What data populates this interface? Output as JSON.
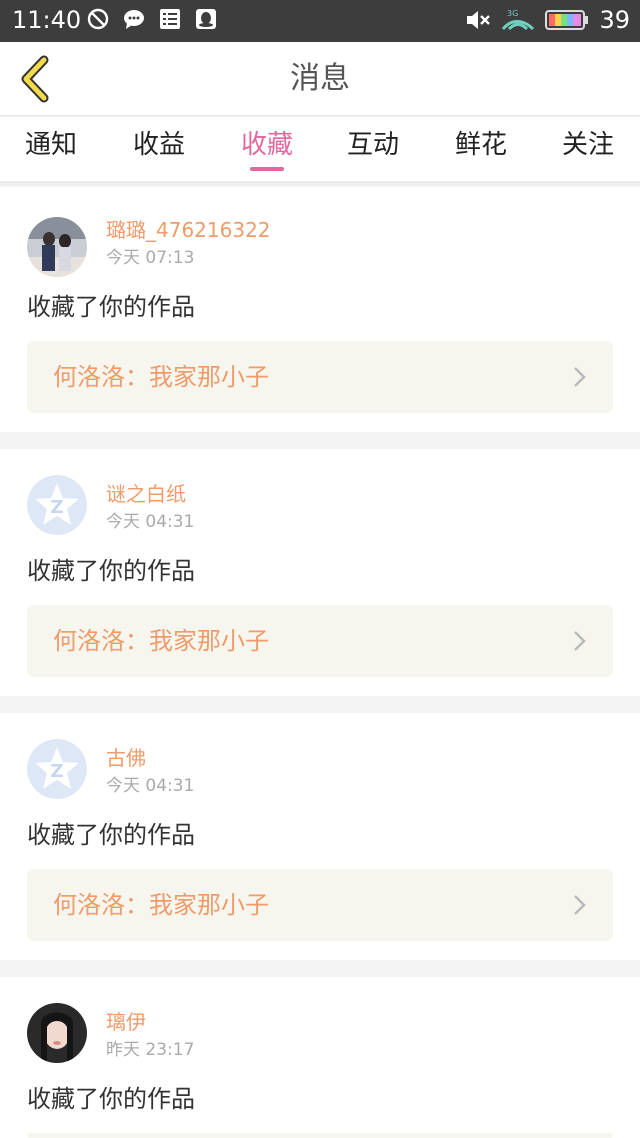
{
  "status_bar": {
    "time": "11:40",
    "battery": "39",
    "icons": [
      "block-icon",
      "chat-icon",
      "list-icon",
      "qq-icon",
      "mute-icon",
      "network-3g-icon",
      "battery-icon"
    ]
  },
  "header": {
    "title": "消息",
    "back_icon": "back-arrow-icon"
  },
  "tabs": [
    {
      "label": "通知",
      "active": false
    },
    {
      "label": "收益",
      "active": false
    },
    {
      "label": "收藏",
      "active": true
    },
    {
      "label": "互动",
      "active": false
    },
    {
      "label": "鲜花",
      "active": false
    },
    {
      "label": "关注",
      "active": false
    }
  ],
  "colors": {
    "accent_pink": "#e5689c",
    "name_orange": "#f09b69",
    "work_box_bg": "#f6f6ef"
  },
  "messages": [
    {
      "username": "璐璐_476216322",
      "time": "今天 07:13",
      "action": "收藏了你的作品",
      "work": "何洛洛：我家那小子",
      "avatar": "photo-avatar"
    },
    {
      "username": "谜之白纸",
      "time": "今天 04:31",
      "action": "收藏了你的作品",
      "work": "何洛洛：我家那小子",
      "avatar": "default-qq-avatar"
    },
    {
      "username": "古佛",
      "time": "今天 04:31",
      "action": "收藏了你的作品",
      "work": "何洛洛：我家那小子",
      "avatar": "default-qq-avatar"
    },
    {
      "username": "璃伊",
      "time": "昨天 23:17",
      "action": "收藏了你的作品",
      "work": "",
      "avatar": "photo-avatar"
    }
  ]
}
